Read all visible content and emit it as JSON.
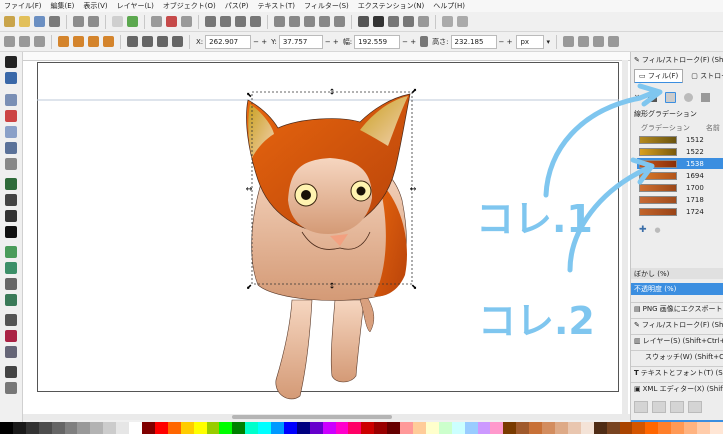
{
  "menubar": {
    "items": [
      "ファイル(F)",
      "編集(E)",
      "表示(V)",
      "レイヤー(L)",
      "オブジェクト(O)",
      "パス(P)",
      "テキスト(T)",
      "フィルター(S)",
      "エクステンション(N)",
      "ヘルプ(H)"
    ]
  },
  "controls": {
    "x_label": "X:",
    "x_value": "262.907",
    "y_label": "Y:",
    "y_value": "37.757",
    "w_label": "幅:",
    "w_value": "192.559",
    "h_label": "高さ:",
    "h_value": "232.185",
    "unit": "px"
  },
  "dock": {
    "title": "フィル/ストローク(F) (Shift+Ctrl",
    "tab_fill": "フィル(F)",
    "tab_stroke": "ストロー",
    "gradient_type": "線形グラデーション",
    "col_gradient": "グラデーション",
    "col_name": "名前",
    "gradients": [
      {
        "name": "1512",
        "color_a": "#b58a1e",
        "color_b": "#6a5410"
      },
      {
        "name": "1522",
        "color_a": "#d9a020",
        "color_b": "#7a5a0c"
      },
      {
        "name": "1538",
        "color_a": "#c7561a",
        "color_b": "#8a2f06"
      },
      {
        "name": "1694",
        "color_a": "#d87a2a",
        "color_b": "#b2541a"
      },
      {
        "name": "1700",
        "color_a": "#d07032",
        "color_b": "#9c4818"
      },
      {
        "name": "1718",
        "color_a": "#c86a34",
        "color_b": "#a04c1c"
      },
      {
        "name": "1724",
        "color_a": "#c2642a",
        "color_b": "#9a4418"
      }
    ],
    "selected_gradient": "1538",
    "blur_label": "ぼかし (%)",
    "opacity_label": "不透明度 (%)",
    "panels": [
      "PNG 画像にエクスポート(E) (",
      "フィル/ストローク(F) (Shift+C",
      "レイヤー(S) (Shift+Ctrl+L)",
      "スウォッチ(W) (Shift+Ctrl+W",
      "テキストとフォント(T) (Shift+",
      "XML エディター(X) (Shift+Ctrl"
    ]
  },
  "annotations": {
    "label_1": "コレ.1",
    "label_2": "コレ.2",
    "color": "#7fc6ef"
  },
  "palette": [
    "#000000",
    "#1a1a1a",
    "#333333",
    "#4d4d4d",
    "#666666",
    "#808080",
    "#999999",
    "#b3b3b3",
    "#cccccc",
    "#e6e6e6",
    "#ffffff",
    "#800000",
    "#ff0000",
    "#ff6600",
    "#ffcc00",
    "#ffff00",
    "#99cc00",
    "#00ff00",
    "#008000",
    "#00ffcc",
    "#00ffff",
    "#0099ff",
    "#0000ff",
    "#000080",
    "#6600cc",
    "#cc00ff",
    "#ff00cc",
    "#ff0066",
    "#cc0000",
    "#990000",
    "#660000",
    "#ff9999",
    "#ffcc99",
    "#ffffcc",
    "#ccffcc",
    "#ccffff",
    "#99ccff",
    "#cc99ff",
    "#ff99cc",
    "#7a3b00",
    "#a05a2c",
    "#c87137",
    "#d38d5f",
    "#deaa87",
    "#e9c6af",
    "#f4e3d7",
    "#502d16",
    "#784421",
    "#aa4400",
    "#d45500",
    "#ff6600",
    "#ff7f2a",
    "#ff9955",
    "#ffb380",
    "#ffccaa",
    "#ffe6d5"
  ]
}
